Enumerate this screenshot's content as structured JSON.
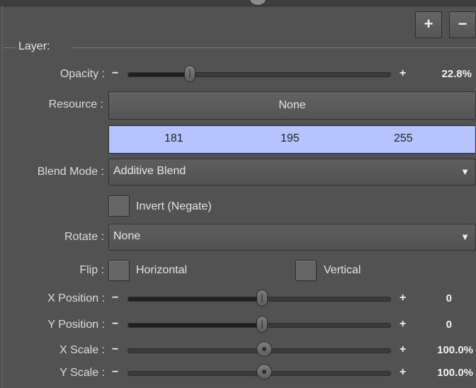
{
  "toolbar": {
    "add_label": "+",
    "remove_label": "−"
  },
  "layer": {
    "legend": "Layer:",
    "opacity": {
      "label": "Opacity :",
      "value_text": "22.8%",
      "fraction": 0.228,
      "minus": "−",
      "plus": "+"
    },
    "resource": {
      "label": "Resource :",
      "value": "None"
    },
    "color": {
      "r": "181",
      "g": "195",
      "b": "255",
      "hex": "#b5c3ff"
    },
    "blend_mode": {
      "label": "Blend Mode :",
      "value": "Additive Blend"
    },
    "invert": {
      "label": "Invert (Negate)",
      "checked": false
    },
    "rotate": {
      "label": "Rotate :",
      "value": "None"
    },
    "flip": {
      "label": "Flip :",
      "horizontal": "Horizontal",
      "vertical": "Vertical"
    },
    "x_position": {
      "label": "X Position :",
      "value_text": "0",
      "fraction": 0.5,
      "minus": "−",
      "plus": "+"
    },
    "y_position": {
      "label": "Y Position :",
      "value_text": "0",
      "fraction": 0.5,
      "minus": "−",
      "plus": "+"
    },
    "x_scale": {
      "label": "X Scale :",
      "value_text": "100.0%",
      "minus": "−",
      "plus": "+"
    },
    "y_scale": {
      "label": "Y Scale :",
      "value_text": "100.0%",
      "minus": "−",
      "plus": "+"
    }
  },
  "icons": {
    "dropdown_arrow": "triangle-down-icon"
  }
}
